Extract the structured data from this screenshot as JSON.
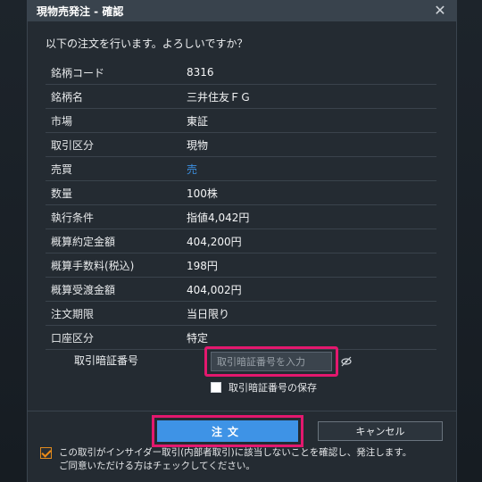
{
  "dialog": {
    "title": "現物売発注 - 確認",
    "question": "以下の注文を行います。よろしいですか？",
    "rows": [
      {
        "label": "銘柄コード",
        "value": "8316"
      },
      {
        "label": "銘柄名",
        "value": "三井住友ＦＧ"
      },
      {
        "label": "市場",
        "value": "東証"
      },
      {
        "label": "取引区分",
        "value": "現物"
      },
      {
        "label": "売買",
        "value": "売"
      },
      {
        "label": "数量",
        "value": "100株"
      },
      {
        "label": "執行条件",
        "value": "指値4,042円"
      },
      {
        "label": "概算約定金額",
        "value": "404,200円"
      },
      {
        "label": "概算手数料(税込)",
        "value": "198円"
      },
      {
        "label": "概算受渡金額",
        "value": "404,002円"
      },
      {
        "label": "注文期限",
        "value": "当日限り"
      },
      {
        "label": "口座区分",
        "value": "特定"
      }
    ],
    "pin": {
      "label": "取引暗証番号",
      "placeholder": "取引暗証番号を入力",
      "save_label": "取引暗証番号の保存"
    },
    "buttons": {
      "order": "注文",
      "cancel": "キャンセル"
    },
    "confirm_text_line1": "この取引がインサイダー取引(内部者取引)に該当しないことを確認し、発注します。",
    "confirm_text_line2": "ご同意いただける方はチェックしてください。",
    "confirm_checked": true
  },
  "colors": {
    "accent": "#3e93e6",
    "highlight": "#e3186e",
    "sell": "#3b8fe0",
    "check": "#f08c16"
  }
}
